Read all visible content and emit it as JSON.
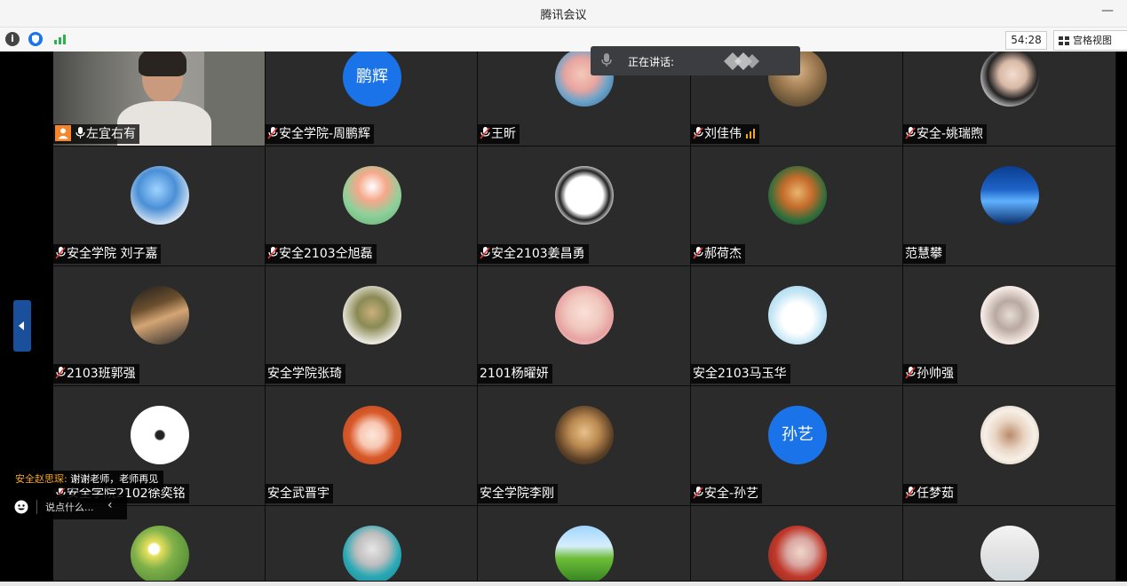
{
  "window": {
    "title": "腾讯会议",
    "minimize": "—"
  },
  "toolbar": {
    "info": "i",
    "timer": "54:28",
    "view_label": "宫格视图"
  },
  "speaking": {
    "label": "正在讲话:"
  },
  "colors": {
    "accent": "#1a73e8",
    "tile_bg": "#2b2b2b",
    "name_bg": "#000000",
    "chat_sender": "#f5a623"
  },
  "participants": [
    {
      "name": "左宜右有",
      "mic": "on",
      "host_icon": true,
      "avatar": "video"
    },
    {
      "name": "安全学院-周鹏辉",
      "mic": "muted",
      "avatar": "initials",
      "initials": "鹏辉"
    },
    {
      "name": "王昕",
      "mic": "muted",
      "avatar": "photo-baby"
    },
    {
      "name": "刘佳伟",
      "mic": "muted",
      "volume": true,
      "avatar": "photo-man"
    },
    {
      "name": "安全-姚瑞煦",
      "mic": "muted",
      "avatar": "photo-woman"
    },
    {
      "name": "安全学院 刘子嘉",
      "mic": "muted",
      "avatar": "photo-anime-blue"
    },
    {
      "name": "安全2103仝旭磊",
      "mic": "muted",
      "avatar": "photo-cartoon-green"
    },
    {
      "name": "安全2103姜昌勇",
      "mic": "muted",
      "avatar": "photo-cartoon-glasses"
    },
    {
      "name": "郝荷杰",
      "mic": "muted",
      "avatar": "photo-monkey-king"
    },
    {
      "name": "范慧攀",
      "mic": "none",
      "avatar": "photo-sea"
    },
    {
      "name": "2103班郭强",
      "mic": "muted",
      "avatar": "photo-bridge"
    },
    {
      "name": "安全学院张琦",
      "mic": "none",
      "avatar": "photo-toy"
    },
    {
      "name": "2101杨曜妍",
      "mic": "none",
      "avatar": "photo-girl-cartoon"
    },
    {
      "name": "安全2103马玉华",
      "mic": "none",
      "avatar": "photo-bunny"
    },
    {
      "name": "孙帅强",
      "mic": "muted",
      "avatar": "photo-cat"
    },
    {
      "name": "安全学院2102徐奕铭",
      "mic": "muted",
      "avatar": "photo-white-icon"
    },
    {
      "name": "安全武晋宇",
      "mic": "none",
      "avatar": "photo-red-hair"
    },
    {
      "name": "安全学院李刚",
      "mic": "none",
      "avatar": "photo-mask"
    },
    {
      "name": "安全-孙艺",
      "mic": "muted",
      "avatar": "initials",
      "initials": "孙艺"
    },
    {
      "name": "任梦茹",
      "mic": "muted",
      "avatar": "photo-basket"
    },
    {
      "name": "",
      "mic": "none",
      "avatar": "photo-daisies"
    },
    {
      "name": "",
      "mic": "none",
      "avatar": "photo-anime-silver"
    },
    {
      "name": "",
      "mic": "none",
      "avatar": "photo-green-hill"
    },
    {
      "name": "",
      "mic": "none",
      "avatar": "photo-sunglasses"
    },
    {
      "name": "",
      "mic": "none",
      "avatar": "photo-whiteboard"
    }
  ],
  "chat": {
    "sender": "安全赵思琛:",
    "message": "谢谢老师，老师再见",
    "placeholder": "说点什么...",
    "collapse": "‹"
  }
}
